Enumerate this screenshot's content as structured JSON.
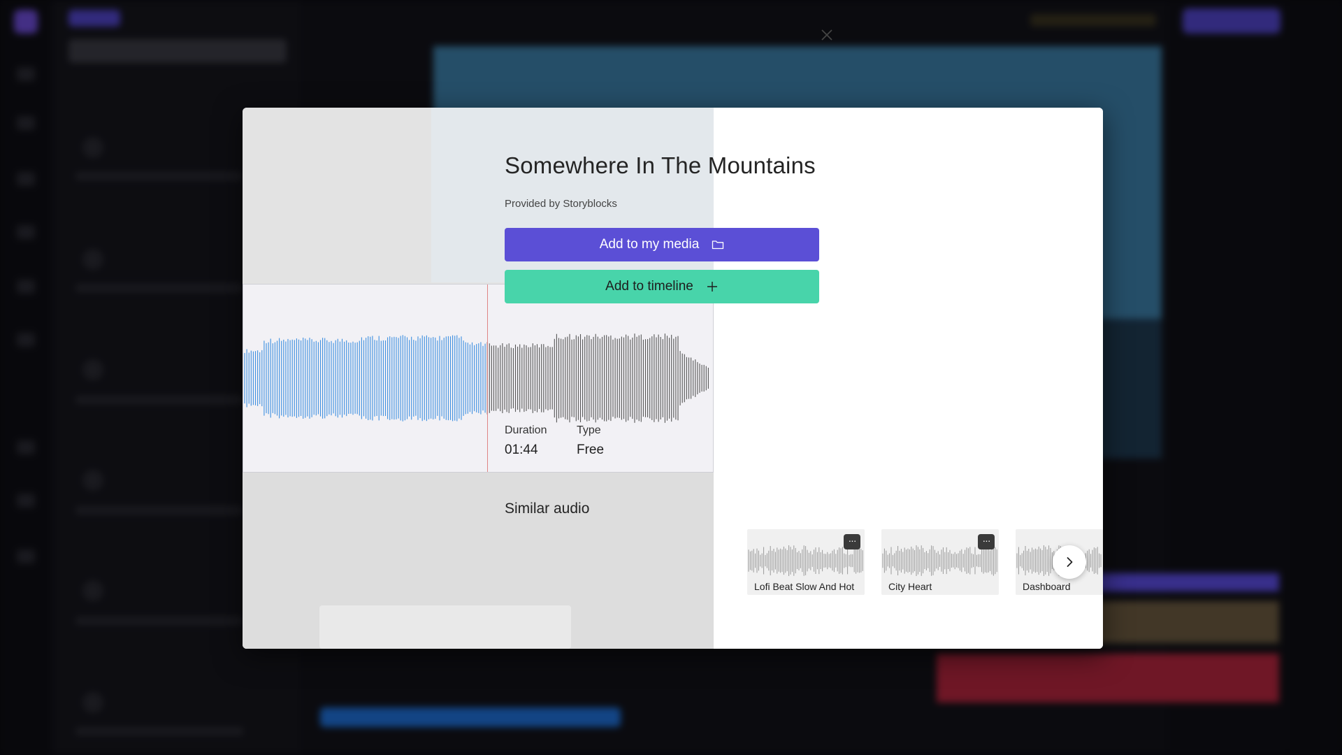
{
  "dialog": {
    "title": "Somewhere In The Mountains",
    "provider": "Provided by Storyblocks",
    "close_icon": "close-icon"
  },
  "actions": {
    "add_media_label": "Add to my media",
    "add_media_icon": "folder-icon",
    "add_timeline_label": "Add to timeline",
    "add_timeline_icon": "plus-icon"
  },
  "meta": {
    "duration_label": "Duration",
    "duration_value": "01:44",
    "type_label": "Type",
    "type_value": "Free"
  },
  "similar": {
    "heading": "Similar audio",
    "items": [
      {
        "title": "Lofi Beat Slow And Hot",
        "more": "···"
      },
      {
        "title": "City Heart",
        "more": "···"
      },
      {
        "title": "Dashboard"
      }
    ],
    "next_icon": "chevron-right-icon"
  },
  "waveform": {
    "played_fraction": 0.52,
    "played_color": "#3d8fe0",
    "unplayed_color": "#555555",
    "playhead_color": "#e08585"
  },
  "colors": {
    "primary": "#5b4fd6",
    "accent": "#48d4aa"
  }
}
